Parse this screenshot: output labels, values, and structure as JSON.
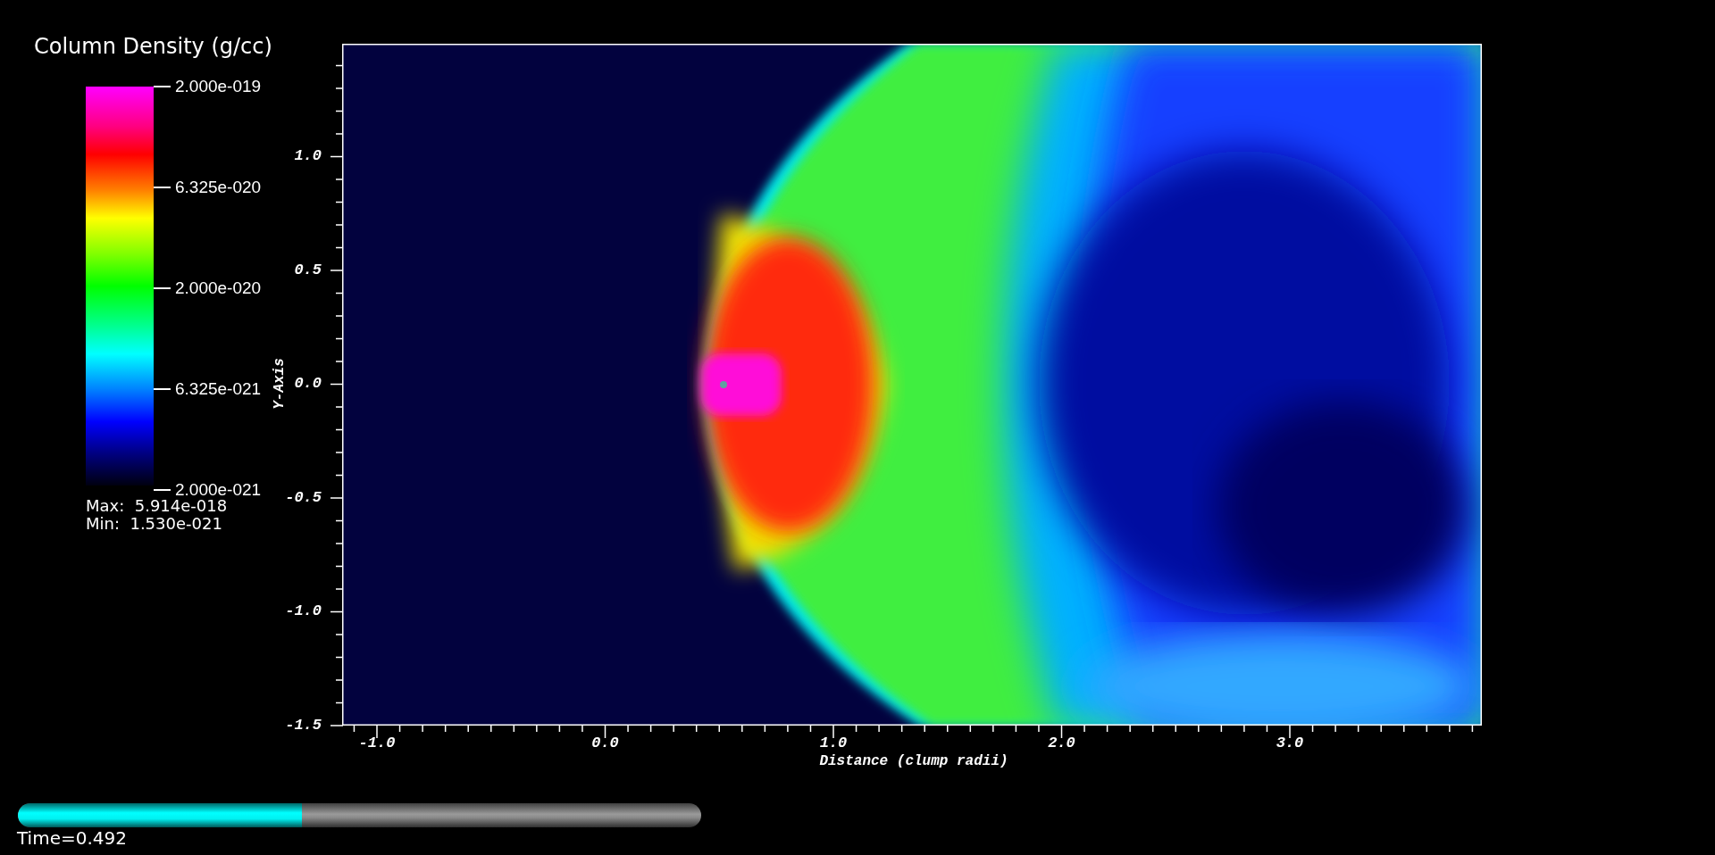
{
  "legend": {
    "title": "Column Density (g/cc)",
    "ticks": [
      "2.000e-019",
      "6.325e-020",
      "2.000e-020",
      "6.325e-021",
      "2.000e-021"
    ],
    "max": "Max:  5.914e-018",
    "min": "Min:  1.530e-021"
  },
  "plot": {
    "y_axis": {
      "title": "Y-Axis",
      "ticks": [
        "1.0",
        "0.5",
        "0.0",
        "-0.5",
        "-1.0",
        "-1.5"
      ]
    },
    "x_axis": {
      "title": "Distance (clump radii)",
      "ticks": [
        "-1.0",
        "0.0",
        "1.0",
        "2.0",
        "3.0"
      ]
    }
  },
  "time_slider": {
    "level": 0.416,
    "label": "Time=0.492"
  }
}
